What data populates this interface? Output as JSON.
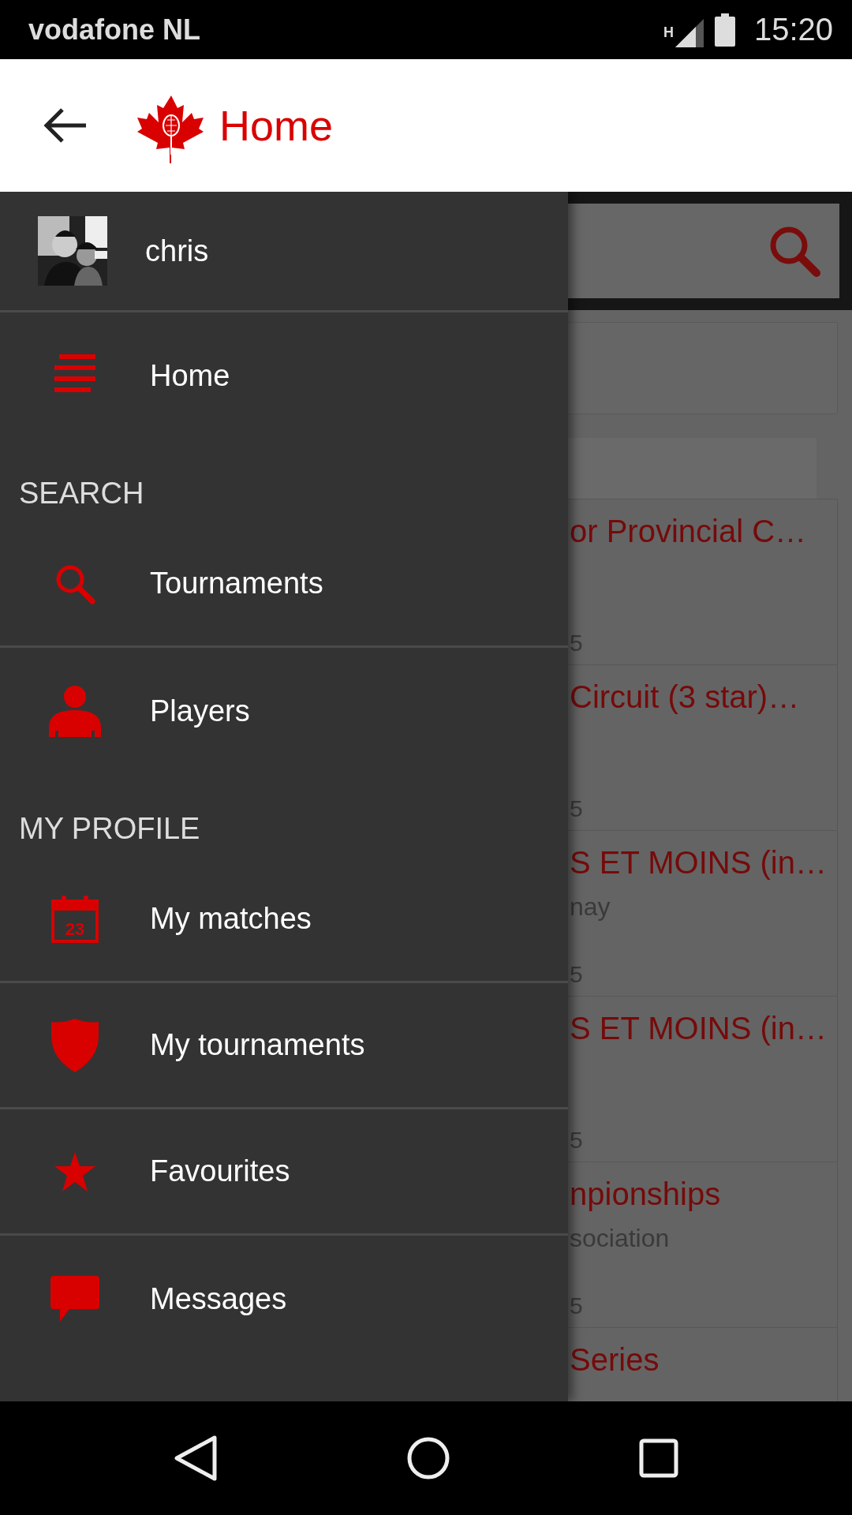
{
  "status_bar": {
    "carrier": "vodafone NL",
    "network": "H",
    "time": "15:20"
  },
  "app_bar": {
    "title": "Home"
  },
  "drawer": {
    "user": {
      "name": "chris"
    },
    "sections": [
      {
        "items": [
          {
            "label": "Home",
            "kind": "list"
          }
        ]
      },
      {
        "header": "SEARCH",
        "items": [
          {
            "label": "Tournaments",
            "kind": "search"
          },
          {
            "label": "Players",
            "kind": "person"
          }
        ]
      },
      {
        "header": "MY PROFILE",
        "items": [
          {
            "label": "My matches",
            "kind": "calendar",
            "icon_text": "23"
          },
          {
            "label": "My tournaments",
            "kind": "shield"
          },
          {
            "label": "Favourites",
            "kind": "star"
          },
          {
            "label": "Messages",
            "kind": "chat"
          }
        ]
      }
    ]
  },
  "background": {
    "rows": [
      {
        "title": "or Provincial C…",
        "date": "5"
      },
      {
        "title": "Circuit (3 star)…",
        "date": "5"
      },
      {
        "title": "S ET MOINS (in…",
        "subtitle": "nay",
        "date": "5"
      },
      {
        "title": "S ET MOINS (in…",
        "date": "5"
      },
      {
        "title": "npionships",
        "subtitle": "sociation",
        "date": "5"
      },
      {
        "title": "Series"
      }
    ]
  }
}
